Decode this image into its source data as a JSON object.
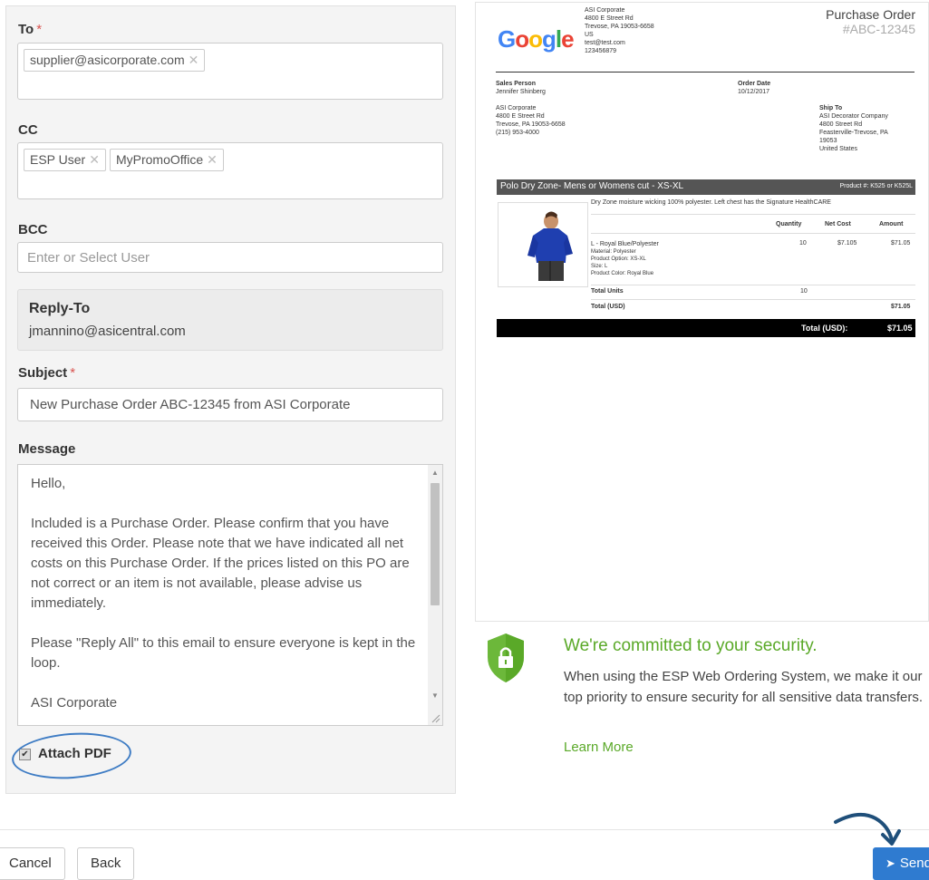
{
  "form": {
    "to": {
      "label": "To",
      "required": "*",
      "tags": [
        "supplier@asicorporate.com"
      ]
    },
    "cc": {
      "label": "CC",
      "tags": [
        "ESP User",
        "MyPromoOffice"
      ]
    },
    "bcc": {
      "label": "BCC",
      "placeholder": "Enter or Select User"
    },
    "reply_to": {
      "label": "Reply-To",
      "value": "jmannino@asicentral.com"
    },
    "subject": {
      "label": "Subject",
      "required": "*",
      "value": "New Purchase Order ABC-12345 from ASI Corporate"
    },
    "message": {
      "label": "Message",
      "paragraphs": [
        "Hello,",
        "Included is a Purchase Order. Please confirm that you have received this Order. Please note that we have indicated all net costs on this Purchase Order. If the prices listed on this PO are not correct or an item is not available, please advise us immediately.",
        "Please \"Reply All\" to this email to ensure everyone is kept in the loop.",
        "ASI Corporate"
      ]
    },
    "attach_pdf": {
      "label": "Attach PDF",
      "checked": true
    }
  },
  "po": {
    "logo": "Google",
    "company_lines": [
      "ASI Corporate",
      "4800 E Street Rd",
      "Trevose, PA 19053-6658",
      "US",
      "test@test.com",
      "123456879"
    ],
    "title": "Purchase Order",
    "number": "#ABC-12345",
    "sales_person_label": "Sales Person",
    "sales_person": "Jennifer Shinberg",
    "order_date_label": "Order Date",
    "order_date": "10/12/2017",
    "bill_lines": [
      "ASI Corporate",
      "4800 E Street Rd",
      "Trevose, PA 19053-6658",
      "(215) 953-4000"
    ],
    "ship_to_label": "Ship To",
    "ship_lines": [
      "ASI Decorator Company",
      "4800 Street Rd",
      "Feasterville-Trevose, PA",
      "19053",
      "United States"
    ],
    "product_title": "Polo Dry Zone- Mens or Womens cut - XS-XL",
    "product_number": "Product #: K525 or K525L",
    "product_desc": "Dry Zone moisture wicking 100% polyester. Left chest has the Signature HealthCARE",
    "col_quantity": "Quantity",
    "col_net_cost": "Net Cost",
    "col_amount": "Amount",
    "item_name": "L - Royal Blue/Polyester",
    "item_details": [
      "Material: Polyester",
      "Product Option: XS-XL",
      "Size: L",
      "Product Color: Royal Blue"
    ],
    "item_qty": "10",
    "item_cost": "$7.105",
    "item_amount": "$71.05",
    "total_units_label": "Total Units",
    "total_units": "10",
    "total_usd_label": "Total (USD)",
    "total_usd": "$71.05",
    "grand_total_label": "Total (USD):",
    "grand_total": "$71.05"
  },
  "security": {
    "title": "We're committed to your security.",
    "text": "When using the ESP Web Ordering System, we make it our top priority to ensure security for all sensitive data transfers.",
    "link": "Learn More"
  },
  "footer": {
    "cancel": "Cancel",
    "back": "Back",
    "send": "Send"
  },
  "colors": {
    "accent_green": "#5aa928",
    "send_blue": "#2f7bd0",
    "required_red": "#d9534f",
    "annotation_blue": "#3e7cc4"
  }
}
